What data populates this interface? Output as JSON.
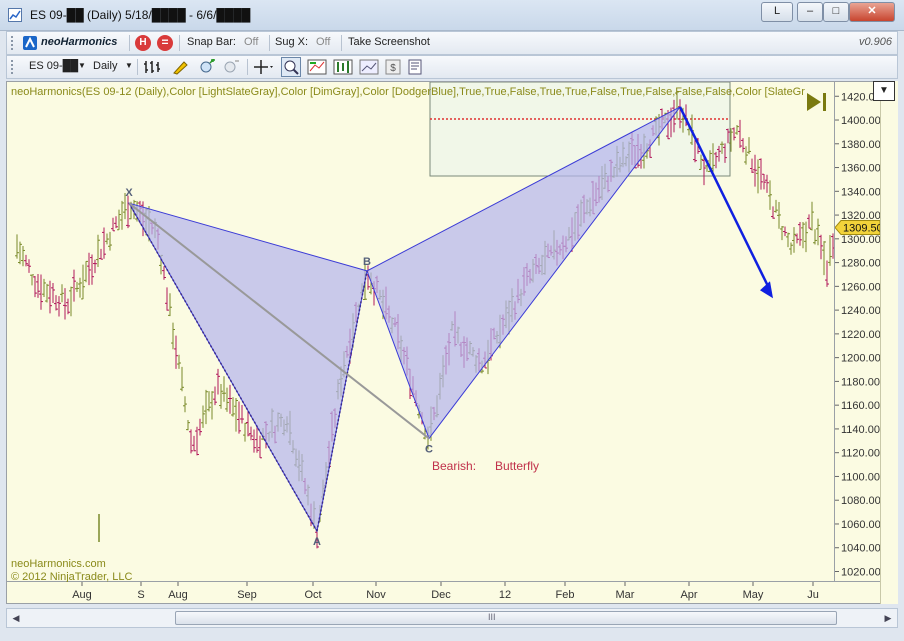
{
  "window": {
    "title": "ES 09-██ (Daily)  5/18/████ - 6/6/████",
    "buttons": {
      "l": "L",
      "minimize": "–",
      "maximize": "□",
      "close": "✕"
    }
  },
  "toolbar1": {
    "brand": "neoHarmonics",
    "h_button": "H",
    "eq_button": "=",
    "snap_bar_label": "Snap Bar:",
    "snap_bar_value": "Off",
    "sug_x_label": "Sug X:",
    "sug_x_value": "Off",
    "screenshot": "Take Screenshot",
    "version": "v0.906"
  },
  "toolbar2": {
    "instrument": "ES 09-██",
    "period": "Daily"
  },
  "chart": {
    "indicator_label": "neoHarmonics(ES 09-12 (Daily),Color [LightSlateGray],Color [DimGray],Color [DodgerBlue],True,True,False,True,True,False,True,False,False,False,Color [SlateGr",
    "watermark1": "neoHarmonics.com",
    "watermark2": "© 2012 NinjaTrader, LLC",
    "pattern_direction": "Bearish:",
    "pattern_name": "Butterfly",
    "points": {
      "x": "X",
      "a": "A",
      "b": "B",
      "c": "C"
    },
    "current_price": "1309.50",
    "colors": {
      "pattern_fill": "#b3b3ee",
      "pattern_stroke": "#3b3bd6",
      "arrow": "#1020e0",
      "up_bar": "#7a8a2a",
      "down_bar": "#b0185a",
      "xc_line": "#999999",
      "prz_line": "#e03030"
    }
  },
  "chart_data": {
    "type": "ohlc",
    "y_ticks": [
      "1420.00",
      "1400.00",
      "1380.00",
      "1360.00",
      "1340.00",
      "1320.00",
      "1300.00",
      "1280.00",
      "1260.00",
      "1240.00",
      "1220.00",
      "1200.00",
      "1180.00",
      "1160.00",
      "1140.00",
      "1120.00",
      "1100.00",
      "1080.00",
      "1060.00",
      "1040.00",
      "1020.00"
    ],
    "x_ticks": [
      "Aug",
      "S",
      "Aug",
      "Sep",
      "Oct",
      "Nov",
      "Dec",
      "12",
      "Feb",
      "Mar",
      "Apr",
      "May",
      "Ju"
    ],
    "ylim": [
      1012,
      1432
    ],
    "pattern": {
      "X": 1330,
      "A": 1054,
      "B": 1273,
      "C": 1132,
      "D": 1411
    },
    "projection_target": 1250
  },
  "scrollbar": {
    "grip": "III"
  }
}
